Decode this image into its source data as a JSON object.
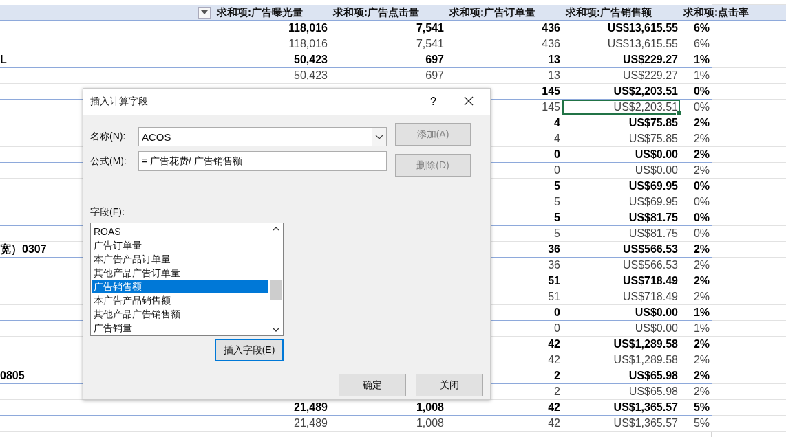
{
  "sheet": {
    "columns": [
      "求和项:广告曝光量",
      "求和项:广告点击量",
      "求和项:广告订单量",
      "求和项:广告销售额",
      "求和项:点击率"
    ],
    "rows": [
      {
        "kind": "total",
        "cells": [
          "118,016",
          "7,541",
          "436",
          "US$13,615.55",
          "6%"
        ]
      },
      {
        "kind": "detail",
        "cells": [
          "118,016",
          "7,541",
          "436",
          "US$13,615.55",
          "6%"
        ]
      },
      {
        "kind": "total",
        "label": "L",
        "cells": [
          "50,423",
          "697",
          "13",
          "US$229.27",
          "1%"
        ]
      },
      {
        "kind": "detail",
        "cells": [
          "50,423",
          "697",
          "13",
          "US$229.27",
          "1%"
        ]
      },
      {
        "kind": "total",
        "cells": [
          null,
          null,
          "145",
          "US$2,203.51",
          "0%"
        ]
      },
      {
        "kind": "detail",
        "cells": [
          null,
          null,
          "145",
          {
            "text": "US$2,203.51",
            "selected": true
          },
          "0%"
        ]
      },
      {
        "kind": "total",
        "cells": [
          null,
          null,
          "4",
          "US$75.85",
          "2%"
        ]
      },
      {
        "kind": "detail",
        "cells": [
          null,
          null,
          "4",
          "US$75.85",
          "2%"
        ]
      },
      {
        "kind": "total",
        "cells": [
          null,
          null,
          "0",
          "US$0.00",
          "2%"
        ]
      },
      {
        "kind": "detail",
        "cells": [
          null,
          null,
          "0",
          "US$0.00",
          "2%"
        ]
      },
      {
        "kind": "total",
        "cells": [
          null,
          null,
          "5",
          "US$69.95",
          "0%"
        ]
      },
      {
        "kind": "detail",
        "cells": [
          null,
          null,
          "5",
          "US$69.95",
          "0%"
        ]
      },
      {
        "kind": "total",
        "cells": [
          null,
          null,
          "5",
          "US$81.75",
          "0%"
        ]
      },
      {
        "kind": "detail",
        "cells": [
          null,
          null,
          "5",
          "US$81.75",
          "0%"
        ]
      },
      {
        "kind": "total",
        "label": "宽）0307",
        "cells": [
          null,
          null,
          "36",
          "US$566.53",
          "2%"
        ]
      },
      {
        "kind": "detail",
        "cells": [
          null,
          null,
          "36",
          "US$566.53",
          "2%"
        ]
      },
      {
        "kind": "total",
        "cells": [
          null,
          null,
          "51",
          "US$718.49",
          "2%"
        ]
      },
      {
        "kind": "detail",
        "cells": [
          null,
          null,
          "51",
          "US$718.49",
          "2%"
        ]
      },
      {
        "kind": "total",
        "cells": [
          null,
          null,
          "0",
          "US$0.00",
          "1%"
        ]
      },
      {
        "kind": "detail",
        "cells": [
          null,
          null,
          "0",
          "US$0.00",
          "1%"
        ]
      },
      {
        "kind": "total",
        "cells": [
          null,
          null,
          "42",
          "US$1,289.58",
          "2%"
        ]
      },
      {
        "kind": "detail",
        "cells": [
          null,
          null,
          "42",
          "US$1,289.58",
          "2%"
        ]
      },
      {
        "kind": "total",
        "label": "0805",
        "cells": [
          null,
          null,
          "2",
          "US$65.98",
          "2%"
        ]
      },
      {
        "kind": "detail",
        "cells": [
          null,
          null,
          "2",
          "US$65.98",
          "2%"
        ]
      },
      {
        "kind": "total",
        "cells": [
          "21,489",
          "1,008",
          "42",
          "US$1,365.57",
          "5%"
        ]
      },
      {
        "kind": "detail",
        "cells": [
          "21,489",
          "1,008",
          "42",
          "US$1,365.57",
          "5%"
        ]
      }
    ]
  },
  "dialog": {
    "title": "插入计算字段",
    "help": "?",
    "name_field": {
      "label": "名称(N):",
      "value": "ACOS"
    },
    "formula_field": {
      "label": "公式(M):",
      "value": "= 广告花费/ 广告销售额"
    },
    "side_buttons": [
      {
        "label": "添加(A)",
        "disabled": true
      },
      {
        "label": "删除(D)",
        "disabled": true
      }
    ],
    "fields": {
      "label": "字段(F):",
      "items": [
        {
          "label": "ROAS",
          "selected": false
        },
        {
          "label": "广告订单量",
          "selected": false
        },
        {
          "label": "本广告产品订单量",
          "selected": false
        },
        {
          "label": "其他产品广告订单量",
          "selected": false
        },
        {
          "label": "广告销售额",
          "selected": true
        },
        {
          "label": "本广告产品销售额",
          "selected": false
        },
        {
          "label": "其他产品广告销售额",
          "selected": false
        },
        {
          "label": "广告销量",
          "selected": false
        }
      ]
    },
    "insert_button": {
      "label": "插入字段(E)",
      "focused": true
    },
    "buttons": [
      "确定",
      "关闭"
    ]
  }
}
